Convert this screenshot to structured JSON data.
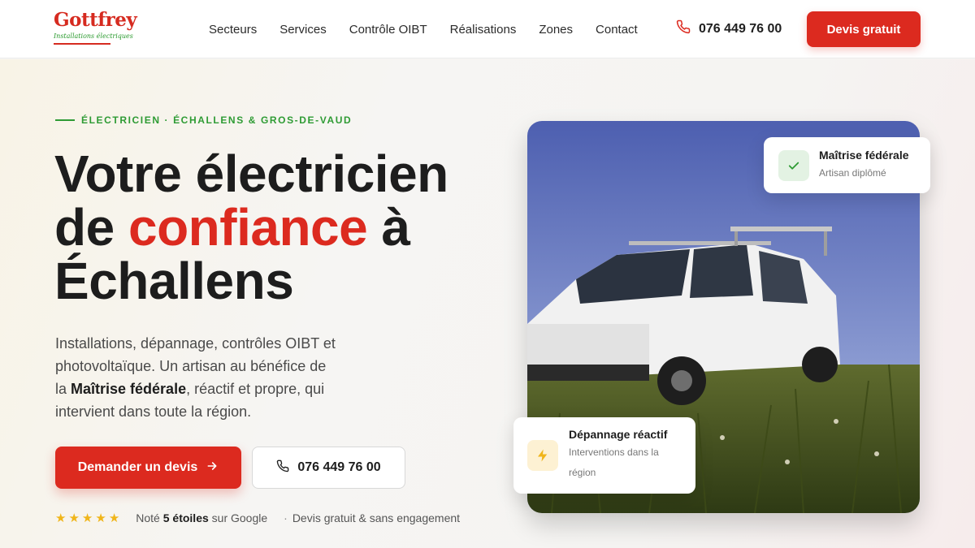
{
  "brand": {
    "logo_name": "Gottfrey",
    "logo_tagline": "Installations électriques",
    "colors": {
      "red": "#dc2a1f",
      "green": "#2e9b34",
      "yellow": "#f0b51a"
    }
  },
  "nav": {
    "links": [
      "Secteurs",
      "Services",
      "Contrôle OIBT",
      "Réalisations",
      "Zones",
      "Contact"
    ],
    "phone": "076 449 76 00",
    "phone_icon": "phone-icon",
    "cta": "Devis gratuit"
  },
  "hero": {
    "eyebrow": "ÉLECTRICIEN · ÉCHALLENS & GROS-DE-VAUD",
    "title_line1": "Votre électricien",
    "title_pre": "de ",
    "title_accent": "confiance",
    "title_post": " à",
    "title_line3": "Échallens",
    "desc_pre": "Installations, dépannage, contrôles OIBT et photovoltaïque. Un artisan au bénéfice de la ",
    "desc_bold": "Maîtrise fédérale",
    "desc_post": ", réactif et propre, qui intervient dans toute la région.",
    "btn_primary": "Demander un devis",
    "btn_primary_icon": "arrow-right-icon",
    "btn_secondary": "076 449 76 00",
    "btn_secondary_icon": "phone-icon",
    "rating": {
      "stars": 5,
      "pre": "Noté ",
      "bold": "5 étoiles",
      "post": " sur Google",
      "extra": "Devis gratuit & sans engagement"
    }
  },
  "cards": {
    "card1": {
      "icon": "check-icon",
      "title": "Maîtrise fédérale",
      "sub": "Artisan diplômé"
    },
    "card2": {
      "icon": "lightning-icon",
      "title": "Dépannage réactif",
      "sub": "Interventions dans la région"
    }
  },
  "photo": {
    "subject": "van-in-field"
  }
}
